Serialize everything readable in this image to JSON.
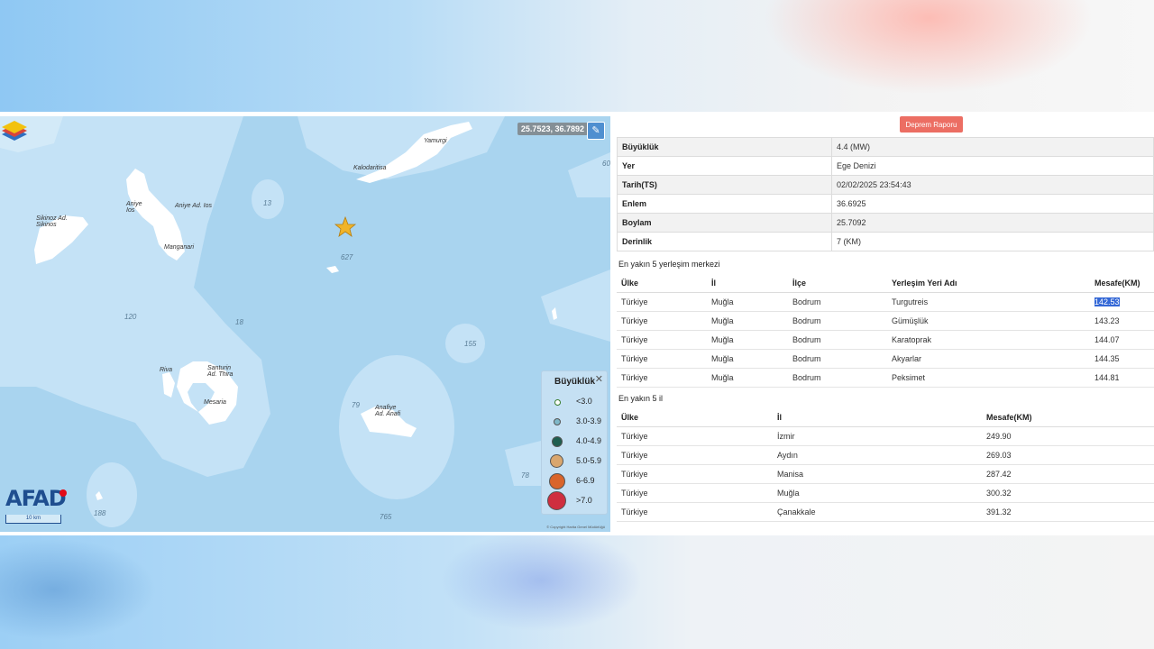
{
  "map": {
    "coords": "25.7523, 36.7892",
    "legend": {
      "title": "Büyüklük",
      "items": [
        {
          "label": "<3.0",
          "color": "#ffffff"
        },
        {
          "label": "3.0-3.9",
          "color": "#7fb8c9"
        },
        {
          "label": "4.0-4.9",
          "color": "#1e5e4f"
        },
        {
          "label": "5.0-5.9",
          "color": "#d9a66e"
        },
        {
          "label": "6-6.9",
          "color": "#d9642b"
        },
        {
          "label": ">7.0",
          "color": "#cf2e3f"
        }
      ]
    },
    "logo": "AFAD",
    "scale": "10 km",
    "copyright": "© Copyright Harita Genel Müdürlüğü",
    "labels": {
      "yamurgi": "Yamurgi",
      "kalodaritisa": "Kalodaritisa",
      "sikinos": "Sikinoz Ad.\nSikinos",
      "aniye": "Aniye\nIos",
      "aniye_ad": "Aniye Ad. Ios",
      "manganari": "Manganari",
      "riva": "Riva",
      "santurin": "Santurin\nAd. Thira",
      "mesaria": "Mesaria",
      "anafiye": "Anafiye\nAd. Anafi"
    },
    "depths": {
      "d13": "13",
      "d627": "627",
      "d120": "120",
      "d18": "18",
      "d155": "155",
      "d79": "79",
      "d78": "78",
      "d188": "188",
      "d765": "765",
      "d60": "60"
    }
  },
  "panel": {
    "report_button": "Deprem Raporu",
    "info": [
      {
        "key": "Büyüklük",
        "value": "4.4 (MW)"
      },
      {
        "key": "Yer",
        "value": "Ege Denizi"
      },
      {
        "key": "Tarih(TS)",
        "value": "02/02/2025 23:54:43"
      },
      {
        "key": "Enlem",
        "value": "36.6925"
      },
      {
        "key": "Boylam",
        "value": "25.7092"
      },
      {
        "key": "Derinlik",
        "value": "7 (KM)"
      }
    ],
    "settlements_title": "En yakın 5 yerleşim merkezi",
    "settlements_headers": [
      "Ülke",
      "İl",
      "İlçe",
      "Yerleşim Yeri Adı",
      "Mesafe(KM)"
    ],
    "settlements": [
      [
        "Türkiye",
        "Muğla",
        "Bodrum",
        "Turgutreis",
        "142.53"
      ],
      [
        "Türkiye",
        "Muğla",
        "Bodrum",
        "Gümüşlük",
        "143.23"
      ],
      [
        "Türkiye",
        "Muğla",
        "Bodrum",
        "Karatoprak",
        "144.07"
      ],
      [
        "Türkiye",
        "Muğla",
        "Bodrum",
        "Akyarlar",
        "144.35"
      ],
      [
        "Türkiye",
        "Muğla",
        "Bodrum",
        "Peksimet",
        "144.81"
      ]
    ],
    "provinces_title": "En yakın 5 il",
    "provinces_headers": [
      "Ülke",
      "İl",
      "Mesafe(KM)"
    ],
    "provinces": [
      [
        "Türkiye",
        "İzmir",
        "249.90"
      ],
      [
        "Türkiye",
        "Aydın",
        "269.03"
      ],
      [
        "Türkiye",
        "Manisa",
        "287.42"
      ],
      [
        "Türkiye",
        "Muğla",
        "300.32"
      ],
      [
        "Türkiye",
        "Çanakkale",
        "391.32"
      ]
    ]
  }
}
